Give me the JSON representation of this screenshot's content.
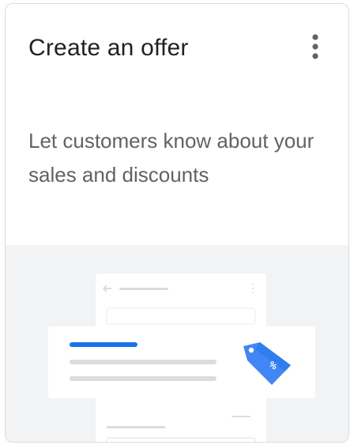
{
  "card": {
    "title": "Create an offer",
    "description": "Let customers know about your sales and discounts",
    "more_menu_icon": "more-vert-icon"
  },
  "illustration": {
    "tag_icon": "discount-tag-icon",
    "tag_glyph": "%",
    "colors": {
      "accent": "#1a73e8",
      "tag": "#4285f4",
      "placeholder_line": "#dadce0",
      "panel_background": "#f1f3f4"
    }
  }
}
